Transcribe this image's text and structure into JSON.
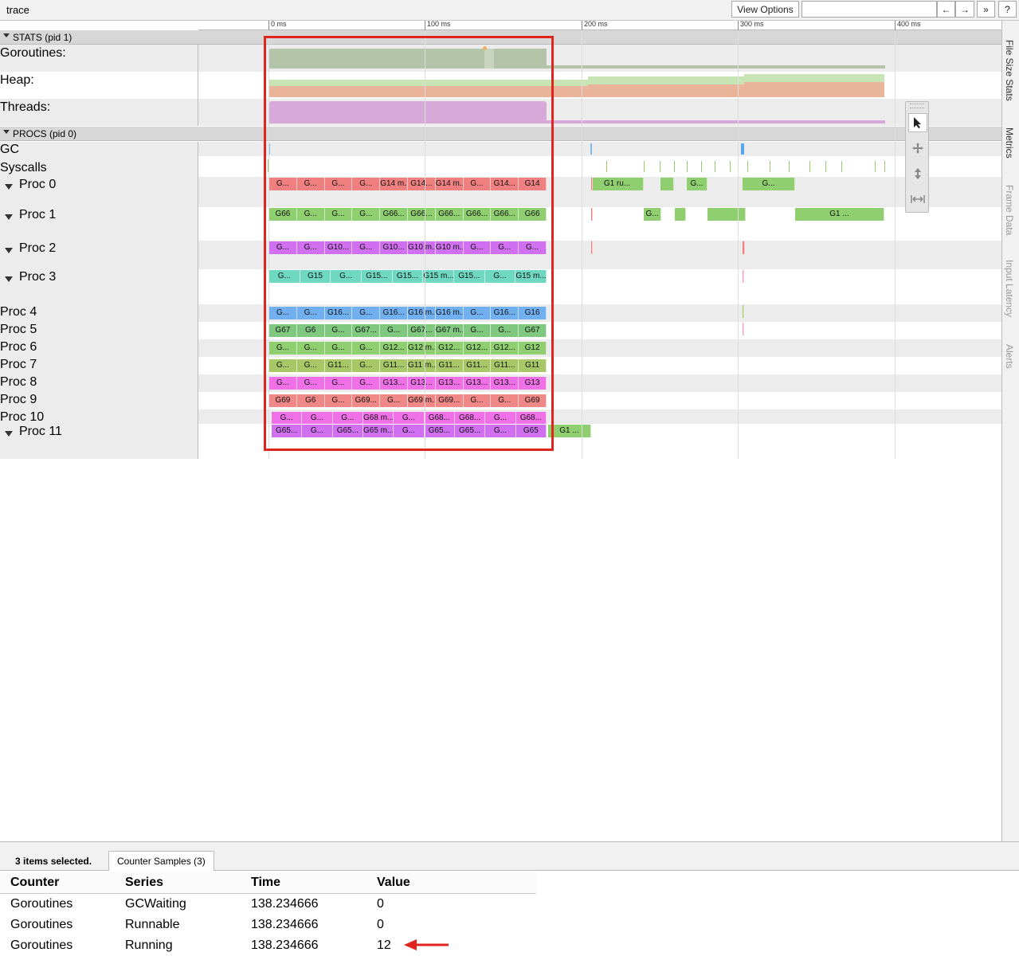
{
  "window": {
    "title": "trace"
  },
  "toolbar": {
    "view_options": "View Options",
    "search_placeholder": "",
    "prev": "←",
    "next": "→",
    "more": "»",
    "help": "?"
  },
  "ruler": {
    "ticks": [
      "0 ms",
      "100 ms",
      "200 ms",
      "300 ms",
      "400 ms"
    ]
  },
  "stats": {
    "header": "STATS (pid 1)",
    "rows": [
      "Goroutines:",
      "Heap:",
      "Threads:"
    ]
  },
  "procs": {
    "header": "PROCS (pid 0)",
    "gc": "GC",
    "syscalls": "Syscalls",
    "rows": [
      {
        "label": "Proc 0",
        "expanded": true,
        "color": "#f08080",
        "slices": [
          "G...",
          "G...",
          "G...",
          "G...",
          "G14 m...",
          "G14...",
          "G14 m...",
          "G...",
          "G14...",
          "G14"
        ]
      },
      {
        "label": "Proc 1",
        "expanded": true,
        "color": "#8fcf6f",
        "slices": [
          "G66",
          "G...",
          "G...",
          "G...",
          "G66...",
          "G66...",
          "G66...",
          "G66...",
          "G66...",
          "G66"
        ]
      },
      {
        "label": "Proc 2",
        "expanded": true,
        "color": "#d070f0",
        "slices": [
          "G...",
          "G...",
          "G10...",
          "G...",
          "G10...",
          "G10 m...",
          "G10 m...",
          "G...",
          "G...",
          "G..."
        ]
      },
      {
        "label": "Proc 3",
        "expanded": true,
        "color": "#6fd8c0",
        "slices": [
          "G...",
          "G15",
          "G...",
          "G15...",
          "G15...",
          "G15 m...",
          "G15...",
          "G...",
          "G15 m..."
        ]
      },
      {
        "label": "Proc 4",
        "expanded": false,
        "color": "#70b0f0",
        "slices": [
          "G...",
          "G...",
          "G16...",
          "G...",
          "G16...",
          "G16 m...",
          "G16 m...",
          "G...",
          "G16...",
          "G16"
        ]
      },
      {
        "label": "Proc 5",
        "expanded": false,
        "color": "#80c880",
        "slices": [
          "G67",
          "G6",
          "G...",
          "G67...",
          "G...",
          "G67...",
          "G67 m...",
          "G...",
          "G...",
          "G67"
        ]
      },
      {
        "label": "Proc 6",
        "expanded": false,
        "color": "#8fcf6f",
        "slices": [
          "G...",
          "G...",
          "G...",
          "G...",
          "G12...",
          "G12 m...",
          "G12...",
          "G12...",
          "G12...",
          "G12"
        ]
      },
      {
        "label": "Proc 7",
        "expanded": false,
        "color": "#a8c868",
        "slices": [
          "G...",
          "G...",
          "G11...",
          "G...",
          "G11...",
          "G11 m...",
          "G11...",
          "G11...",
          "G11...",
          "G11"
        ]
      },
      {
        "label": "Proc 8",
        "expanded": false,
        "color": "#f070e8",
        "slices": [
          "G...",
          "G...",
          "G...",
          "G...",
          "G13...",
          "G13...",
          "G13...",
          "G13...",
          "G13...",
          "G13"
        ]
      },
      {
        "label": "Proc 9",
        "expanded": false,
        "color": "#f08888",
        "slices": [
          "G69",
          "G6",
          "G...",
          "G69...",
          "G...",
          "G69 m...",
          "G69...",
          "G...",
          "G...",
          "G69"
        ]
      },
      {
        "label": "Proc 10",
        "expanded": false,
        "color": "#f070e8",
        "slices": [
          "G...",
          "G...",
          "G...",
          "G68 m...",
          "G...",
          "G68...",
          "G68...",
          "G...",
          "G68..."
        ]
      },
      {
        "label": "Proc 11",
        "expanded": true,
        "color": "#d070f0",
        "slices": [
          "G65...",
          "G...",
          "G65...",
          "G65 m...",
          "G...",
          "G65...",
          "G65...",
          "G...",
          "G65"
        ]
      }
    ],
    "later_labels": {
      "proc0_a": "G1 ru...",
      "proc0_b": "G...",
      "proc0_c": "G...",
      "proc1_a": "G...",
      "proc1_b": "G1 ...",
      "proc11_a": "G1 ..."
    }
  },
  "sidebar_tabs": [
    "File Size Stats",
    "Metrics",
    "Frame Data",
    "Input Latency",
    "Alerts"
  ],
  "bottom": {
    "selection": "3 items selected.",
    "tab": "Counter Samples (3)",
    "columns": [
      "Counter",
      "Series",
      "Time",
      "Value"
    ],
    "rows": [
      {
        "counter": "Goroutines",
        "series": "GCWaiting",
        "time": "138.234666",
        "value": "0"
      },
      {
        "counter": "Goroutines",
        "series": "Runnable",
        "time": "138.234666",
        "value": "0"
      },
      {
        "counter": "Goroutines",
        "series": "Running",
        "time": "138.234666",
        "value": "12"
      }
    ]
  },
  "colors": {
    "highlight": "#e0251f"
  }
}
